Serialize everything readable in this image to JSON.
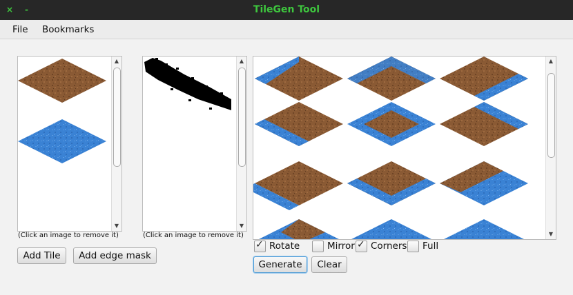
{
  "window": {
    "title": "TileGen Tool",
    "close_glyph": "×",
    "minimize_glyph": "-"
  },
  "menu": [
    "File",
    "Bookmarks"
  ],
  "tiles_panel": {
    "tiles": [
      "dirt-tile",
      "water-tile"
    ],
    "hint": "(Click an image to remove it)"
  },
  "mask_panel": {
    "masks": [
      "diagonal-edge-mask"
    ],
    "hint": "(Click an image to remove it)"
  },
  "output_panel": {
    "rows": [
      [
        "dirt-water-top-left",
        "dirt-water-top",
        "dirt-water-top-right"
      ],
      [
        "dirt-water-left",
        "water-center-patch",
        "dirt-water-right"
      ],
      [
        "dirt-water-bottom-left",
        "dirt-water-bottom",
        "dirt-water-bottom-right"
      ],
      [
        "dirt-water-corner",
        "water-tile",
        "water-tile"
      ]
    ]
  },
  "buttons": {
    "add_tile": "Add Tile",
    "add_edge_mask": "Add edge mask",
    "generate": "Generate",
    "clear": "Clear"
  },
  "options": [
    {
      "label": "Rotate",
      "checked": true
    },
    {
      "label": "Mirror",
      "checked": false
    },
    {
      "label": "Corners",
      "checked": true
    },
    {
      "label": "Full",
      "checked": false
    }
  ],
  "colors": {
    "dirt": "#8a5a34",
    "water": "#3a82d4",
    "title_green": "#3ec63e"
  }
}
